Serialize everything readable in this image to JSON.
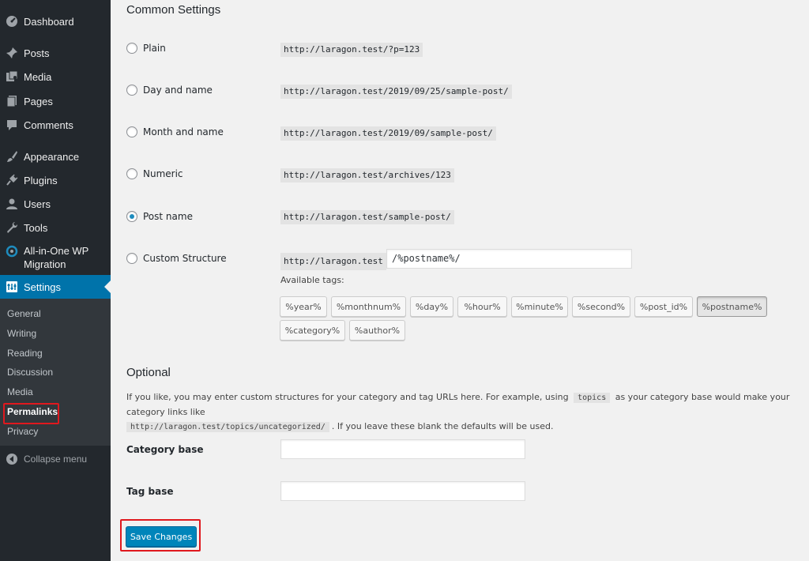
{
  "sidebar": {
    "items": [
      {
        "label": "Dashboard",
        "icon": "dashboard-icon"
      },
      {
        "label": "Posts",
        "icon": "pin-icon"
      },
      {
        "label": "Media",
        "icon": "media-icon"
      },
      {
        "label": "Pages",
        "icon": "page-icon"
      },
      {
        "label": "Comments",
        "icon": "comment-icon"
      },
      {
        "label": "Appearance",
        "icon": "paintbrush-icon"
      },
      {
        "label": "Plugins",
        "icon": "plugin-icon"
      },
      {
        "label": "Users",
        "icon": "user-icon"
      },
      {
        "label": "Tools",
        "icon": "wrench-icon"
      },
      {
        "label": "All-in-One WP",
        "label2": "Migration",
        "icon": "migration-icon"
      },
      {
        "label": "Settings",
        "icon": "settings-icon"
      }
    ],
    "submenu": [
      "General",
      "Writing",
      "Reading",
      "Discussion",
      "Media",
      "Permalinks",
      "Privacy"
    ],
    "collapse_label": "Collapse menu"
  },
  "common": {
    "heading": "Common Settings",
    "options": [
      {
        "label": "Plain",
        "url": "http://laragon.test/?p=123"
      },
      {
        "label": "Day and name",
        "url": "http://laragon.test/2019/09/25/sample-post/"
      },
      {
        "label": "Month and name",
        "url": "http://laragon.test/2019/09/sample-post/"
      },
      {
        "label": "Numeric",
        "url": "http://laragon.test/archives/123"
      },
      {
        "label": "Post name",
        "url": "http://laragon.test/sample-post/"
      },
      {
        "label": "Custom Structure",
        "url": "http://laragon.test"
      }
    ],
    "selected": "Post name",
    "custom_value": "/%postname%/",
    "available_tags_label": "Available tags:",
    "tags": [
      "%year%",
      "%monthnum%",
      "%day%",
      "%hour%",
      "%minute%",
      "%second%",
      "%post_id%",
      "%postname%",
      "%category%",
      "%author%"
    ],
    "active_tag": "%postname%"
  },
  "optional": {
    "heading": "Optional",
    "desc_part1": "If you like, you may enter custom structures for your category and tag URLs here. For example, using",
    "desc_code1": "topics",
    "desc_part2": "as your category base would make your category links like",
    "desc_code2": "http://laragon.test/topics/uncategorized/",
    "desc_part3": ". If you leave these blank the defaults will be used.",
    "category_base_label": "Category base",
    "category_base_value": "",
    "tag_base_label": "Tag base",
    "tag_base_value": ""
  },
  "save_label": "Save Changes",
  "colors": {
    "sidebar_bg": "#23282d",
    "submenu_bg": "#32373c",
    "accent": "#0073aa",
    "button": "#0085ba",
    "highlight_box": "#e0181e"
  }
}
